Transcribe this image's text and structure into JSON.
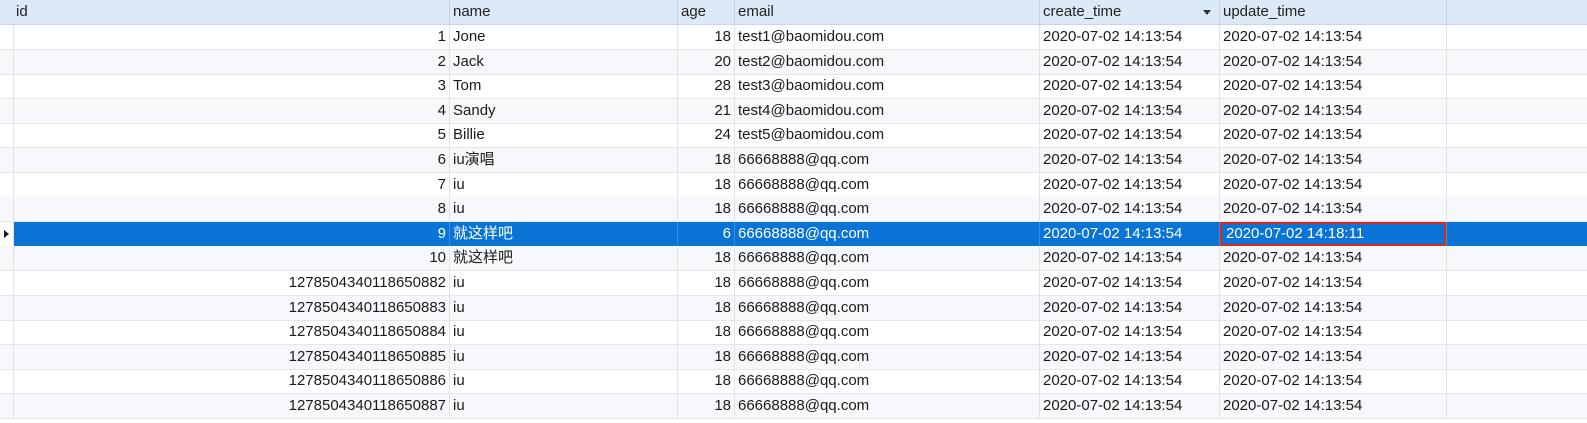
{
  "columns": [
    "id",
    "name",
    "age",
    "email",
    "create_time",
    "update_time"
  ],
  "selected_row": 8,
  "edited_cell": "update_time",
  "sort_column": "create_time",
  "colors": {
    "selected_bg": "#0a74d6",
    "header_bg": "#dce9f7",
    "highlight_border": "#e1261c"
  },
  "rows": [
    {
      "id": "1",
      "name": "Jone",
      "age": "18",
      "email": "test1@baomidou.com",
      "create_time": "2020-07-02 14:13:54",
      "update_time": "2020-07-02 14:13:54"
    },
    {
      "id": "2",
      "name": "Jack",
      "age": "20",
      "email": "test2@baomidou.com",
      "create_time": "2020-07-02 14:13:54",
      "update_time": "2020-07-02 14:13:54"
    },
    {
      "id": "3",
      "name": "Tom",
      "age": "28",
      "email": "test3@baomidou.com",
      "create_time": "2020-07-02 14:13:54",
      "update_time": "2020-07-02 14:13:54"
    },
    {
      "id": "4",
      "name": "Sandy",
      "age": "21",
      "email": "test4@baomidou.com",
      "create_time": "2020-07-02 14:13:54",
      "update_time": "2020-07-02 14:13:54"
    },
    {
      "id": "5",
      "name": "Billie",
      "age": "24",
      "email": "test5@baomidou.com",
      "create_time": "2020-07-02 14:13:54",
      "update_time": "2020-07-02 14:13:54"
    },
    {
      "id": "6",
      "name": "iu演唱",
      "age": "18",
      "email": "66668888@qq.com",
      "create_time": "2020-07-02 14:13:54",
      "update_time": "2020-07-02 14:13:54"
    },
    {
      "id": "7",
      "name": "iu",
      "age": "18",
      "email": "66668888@qq.com",
      "create_time": "2020-07-02 14:13:54",
      "update_time": "2020-07-02 14:13:54"
    },
    {
      "id": "8",
      "name": "iu",
      "age": "18",
      "email": "66668888@qq.com",
      "create_time": "2020-07-02 14:13:54",
      "update_time": "2020-07-02 14:13:54"
    },
    {
      "id": "9",
      "name": "就这样吧",
      "age": "6",
      "email": "66668888@qq.com",
      "create_time": "2020-07-02 14:13:54",
      "update_time": "2020-07-02 14:18:11"
    },
    {
      "id": "10",
      "name": "就这样吧",
      "age": "18",
      "email": "66668888@qq.com",
      "create_time": "2020-07-02 14:13:54",
      "update_time": "2020-07-02 14:13:54"
    },
    {
      "id": "1278504340118650882",
      "name": "iu",
      "age": "18",
      "email": "66668888@qq.com",
      "create_time": "2020-07-02 14:13:54",
      "update_time": "2020-07-02 14:13:54"
    },
    {
      "id": "1278504340118650883",
      "name": "iu",
      "age": "18",
      "email": "66668888@qq.com",
      "create_time": "2020-07-02 14:13:54",
      "update_time": "2020-07-02 14:13:54"
    },
    {
      "id": "1278504340118650884",
      "name": "iu",
      "age": "18",
      "email": "66668888@qq.com",
      "create_time": "2020-07-02 14:13:54",
      "update_time": "2020-07-02 14:13:54"
    },
    {
      "id": "1278504340118650885",
      "name": "iu",
      "age": "18",
      "email": "66668888@qq.com",
      "create_time": "2020-07-02 14:13:54",
      "update_time": "2020-07-02 14:13:54"
    },
    {
      "id": "1278504340118650886",
      "name": "iu",
      "age": "18",
      "email": "66668888@qq.com",
      "create_time": "2020-07-02 14:13:54",
      "update_time": "2020-07-02 14:13:54"
    },
    {
      "id": "1278504340118650887",
      "name": "iu",
      "age": "18",
      "email": "66668888@qq.com",
      "create_time": "2020-07-02 14:13:54",
      "update_time": "2020-07-02 14:13:54"
    }
  ]
}
